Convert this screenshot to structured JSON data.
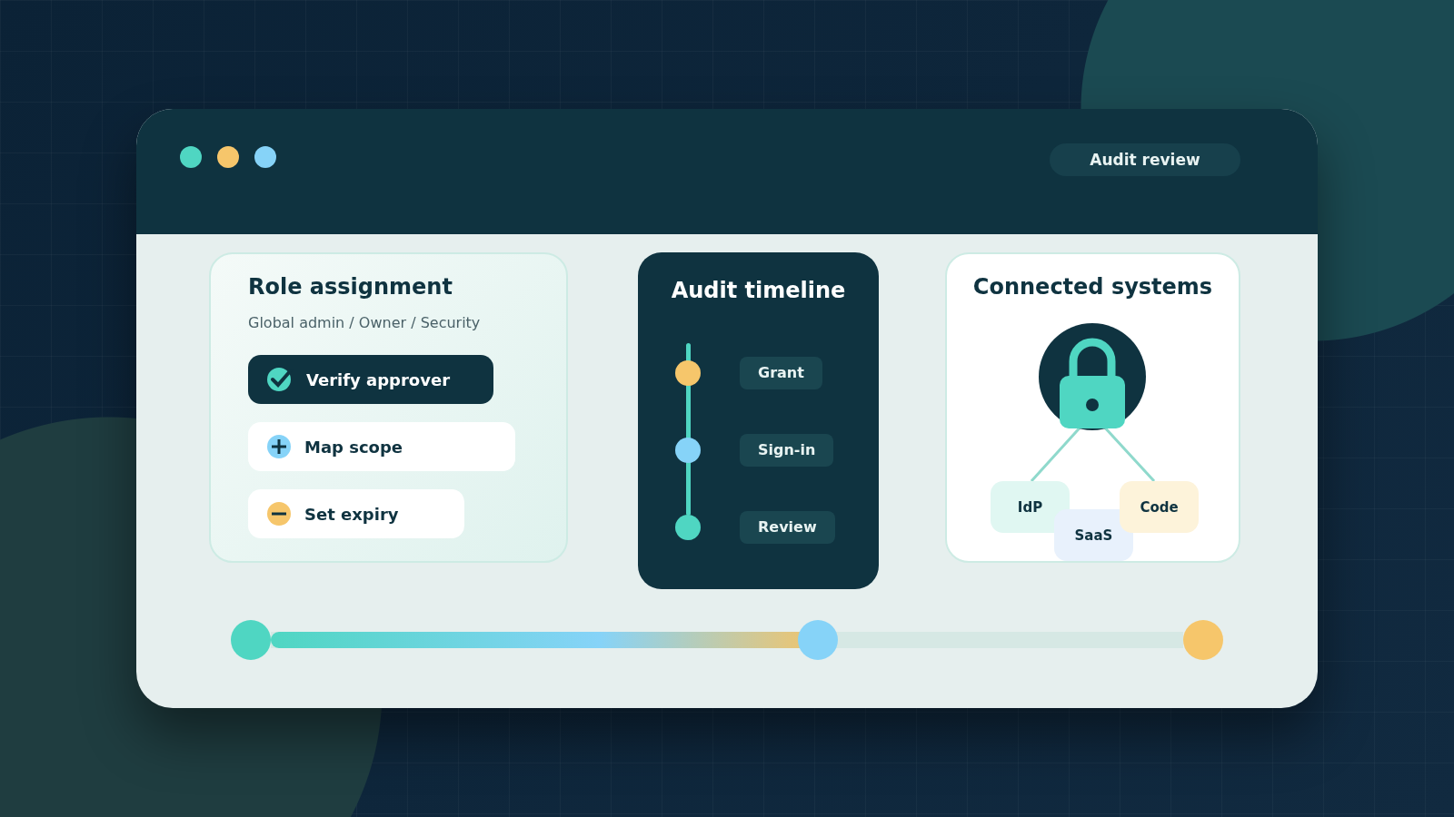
{
  "window": {
    "dots": [
      {
        "color": "#4fd6c2"
      },
      {
        "color": "#f6c66b"
      },
      {
        "color": "#86d3f8"
      }
    ],
    "badge": "Audit review"
  },
  "role_card": {
    "title": "Role assignment",
    "subtitle": "Global admin / Owner / Security",
    "actions": [
      {
        "label": "Verify approver",
        "kind": "check",
        "selected": true
      },
      {
        "label": "Map scope",
        "kind": "add",
        "selected": false
      },
      {
        "label": "Set expiry",
        "kind": "remove",
        "selected": false
      }
    ]
  },
  "timeline": {
    "title": "Audit timeline",
    "steps": [
      {
        "label": "Grant",
        "color": "#f6c66b"
      },
      {
        "label": "Sign-in",
        "color": "#86d3f8"
      },
      {
        "label": "Review",
        "color": "#4fd6c2"
      }
    ]
  },
  "systems": {
    "title": "Connected systems",
    "nodes": [
      {
        "label": "IdP",
        "color": "#e0f7f2"
      },
      {
        "label": "SaaS",
        "color": "#e8f1fc"
      },
      {
        "label": "Code",
        "color": "#fdf3da"
      }
    ]
  },
  "progress": {
    "level": 0.6
  }
}
